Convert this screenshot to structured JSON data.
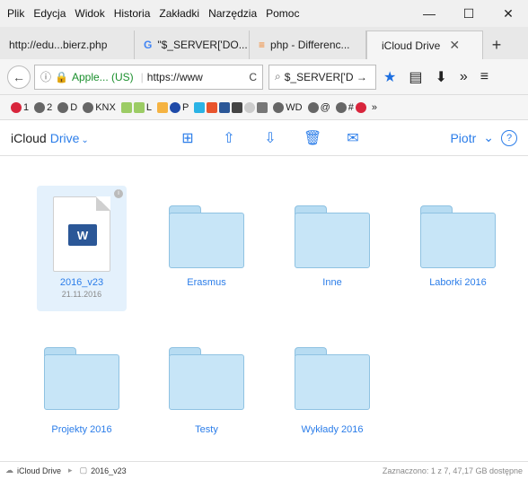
{
  "menu": [
    "Plik",
    "Edycja",
    "Widok",
    "Historia",
    "Zakładki",
    "Narzędzia",
    "Pomoc"
  ],
  "window_controls": {
    "minimize": "—",
    "maximize": "☐",
    "close": "✕"
  },
  "tabs": [
    {
      "label": "http://edu...bierz.php",
      "icon": ""
    },
    {
      "label": "\"$_SERVER['DO...",
      "icon": "G"
    },
    {
      "label": "php - Differenc...",
      "icon": "≡"
    },
    {
      "label": "iCloud Drive",
      "icon": "",
      "active": true
    }
  ],
  "new_tab": "+",
  "nav": {
    "back": "←",
    "url_site": "Apple... (US)",
    "url_text": "https://www",
    "reload": "C",
    "search_value": "$_SERVER['D →"
  },
  "bookmarks": [
    {
      "label": "1"
    },
    {
      "label": "2"
    },
    {
      "label": "D"
    },
    {
      "label": "KNX"
    },
    {
      "label": "L"
    },
    {
      "label": "P"
    },
    {
      "label": "WD"
    },
    {
      "label": "@"
    },
    {
      "label": "#"
    }
  ],
  "app": {
    "title_prefix": "iCloud",
    "title_drive": "Drive",
    "chevron": "⌄",
    "user": "Piotr",
    "help": "?"
  },
  "items": [
    {
      "type": "file",
      "name": "2016_v23",
      "date": "21.11.2016",
      "selected": true
    },
    {
      "type": "folder",
      "name": "Erasmus"
    },
    {
      "type": "folder",
      "name": "Inne"
    },
    {
      "type": "folder",
      "name": "Laborki 2016"
    },
    {
      "type": "folder",
      "name": "Projekty 2016"
    },
    {
      "type": "folder",
      "name": "Testy"
    },
    {
      "type": "folder",
      "name": "Wykłady 2016"
    }
  ],
  "status": {
    "crumb_root": "iCloud Drive",
    "crumb_file": "2016_v23",
    "info": "Zaznaczono: 1 z 7, 47,17 GB dostępne"
  },
  "colors": {
    "accent": "#2b7de9",
    "folder": "#c7e5f7",
    "selected_bg": "#e4f1fc"
  }
}
